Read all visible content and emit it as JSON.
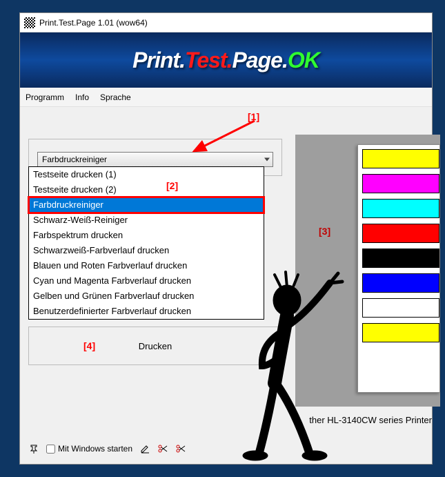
{
  "window": {
    "title": "Print.Test.Page 1.01  (wow64)"
  },
  "banner": {
    "parts": [
      {
        "text": "Print.",
        "color": "#ffffff"
      },
      {
        "text": "Test.",
        "color": "#ff0000"
      },
      {
        "text": "Page.",
        "color": "#ffffff"
      },
      {
        "text": "OK",
        "color": "#00ff00"
      }
    ]
  },
  "menubar": {
    "items": [
      "Programm",
      "Info",
      "Sprache"
    ]
  },
  "dropdown": {
    "selected": "Farbdruckreiniger",
    "options": [
      "Testseite drucken (1)",
      "Testseite drucken (2)",
      "Farbdruckreiniger",
      "Schwarz-Weiß-Reiniger",
      "Farbspektrum drucken",
      "Schwarzweiß-Farbverlauf drucken",
      "Blauen und Roten Farbverlauf drucken",
      "Cyan und Magenta Farbverlauf drucken",
      "Gelben und Grünen Farbverlauf drucken",
      "Benutzerdefinierter Farbverlauf drucken"
    ],
    "selected_index": 2
  },
  "print_button": "Drucken",
  "preview": {
    "strip_colors": [
      "#ffff00",
      "#ff00ff",
      "#00ffff",
      "#ff0000",
      "#000000",
      "#0000ff",
      "#ffffff",
      "#ffff00"
    ]
  },
  "printer_label": "ther HL-3140CW series Printer",
  "bottom": {
    "autostart_label": "Mit Windows starten"
  },
  "annotations": {
    "a1": "[1]",
    "a2": "[2]",
    "a3": "[3]",
    "a4": "[4]"
  }
}
